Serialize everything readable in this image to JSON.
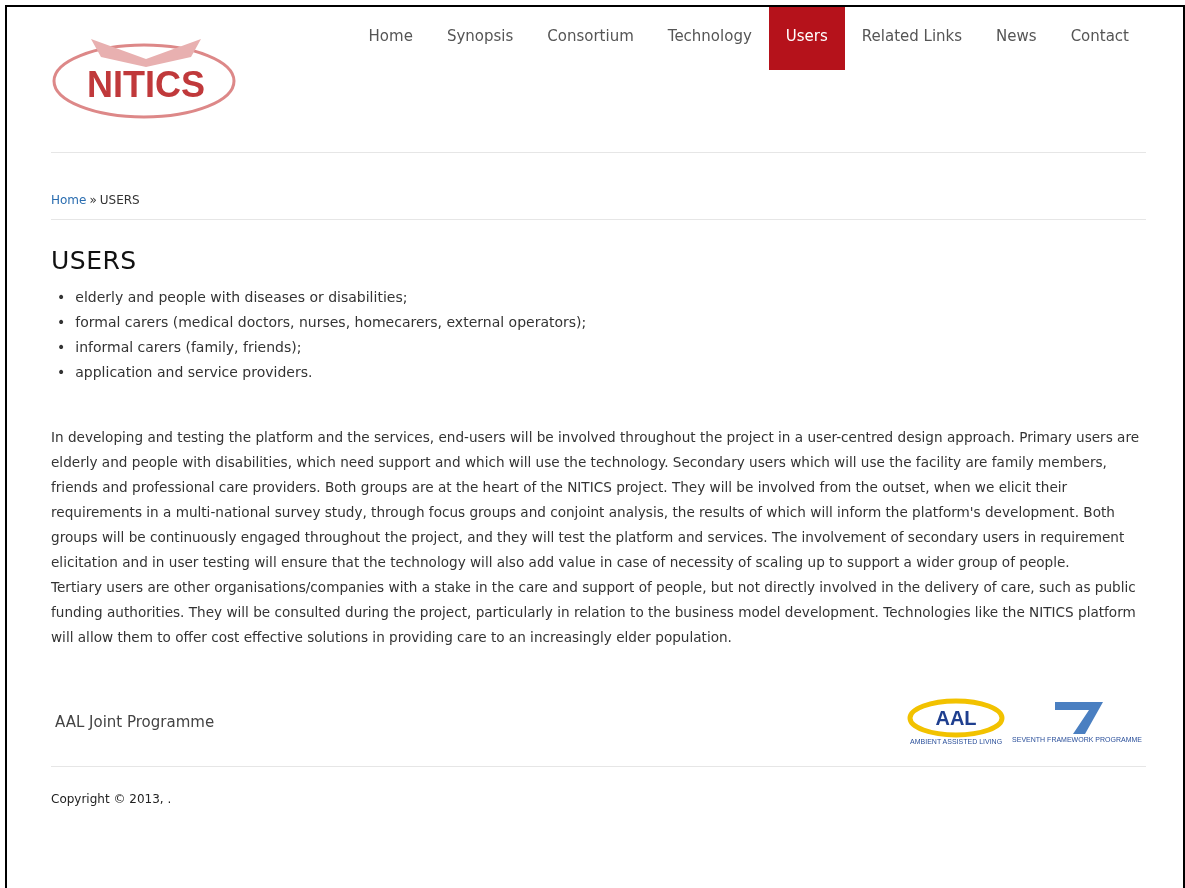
{
  "logo": {
    "text": "NITICS"
  },
  "nav": [
    {
      "label": "Home",
      "selected": false
    },
    {
      "label": "Synopsis",
      "selected": false
    },
    {
      "label": "Consortium",
      "selected": false
    },
    {
      "label": "Technology",
      "selected": false
    },
    {
      "label": "Users",
      "selected": true
    },
    {
      "label": "Related Links",
      "selected": false
    },
    {
      "label": "News",
      "selected": false
    },
    {
      "label": "Contact",
      "selected": false
    }
  ],
  "breadcrumb": {
    "link": "Home",
    "separator": "»",
    "current": "USERS"
  },
  "title": "USERS",
  "bullet": "•",
  "list": [
    "elderly and people with diseases or disabilities;",
    "formal carers (medical doctors, nurses, homecarers, external operators);",
    "informal carers (family, friends);",
    "application and service providers."
  ],
  "paragraphs": [
    "In developing and testing the platform and the services, end-users will be involved throughout the project in a user-centred design approach. Primary users are elderly and people with disabilities, which need support and which will use the technology. Secondary users which will use the facility are family members, friends and professional care providers. Both groups are at the heart of the NITICS project. They will be involved from the outset, when we elicit their requirements in a multi-national survey study, through focus groups and conjoint analysis, the results of which will inform the platform's development. Both groups will be continuously engaged throughout the project, and they will test the platform and services. The involvement of secondary users in requirement elicitation and in user testing will ensure that the technology will also add value in case of necessity of scaling up to support a wider group of people.",
    "Tertiary users are other organisations/companies with a stake in the care and support of people, but not directly involved in the delivery of care, such as public funding authorities. They will be consulted during the project, particularly in relation to the business model development. Technologies like the NITICS platform will allow them to offer cost effective solutions in providing care to an increasingly elder population."
  ],
  "footer": {
    "programme": "AAL Joint Programme",
    "aal_logo": {
      "text": "AAL",
      "subtext": "AMBIENT ASSISTED LIVING"
    },
    "fp7_logo": {
      "text": "SEVENTH FRAMEWORK PROGRAMME"
    },
    "copyright": "Copyright © 2013, ."
  }
}
